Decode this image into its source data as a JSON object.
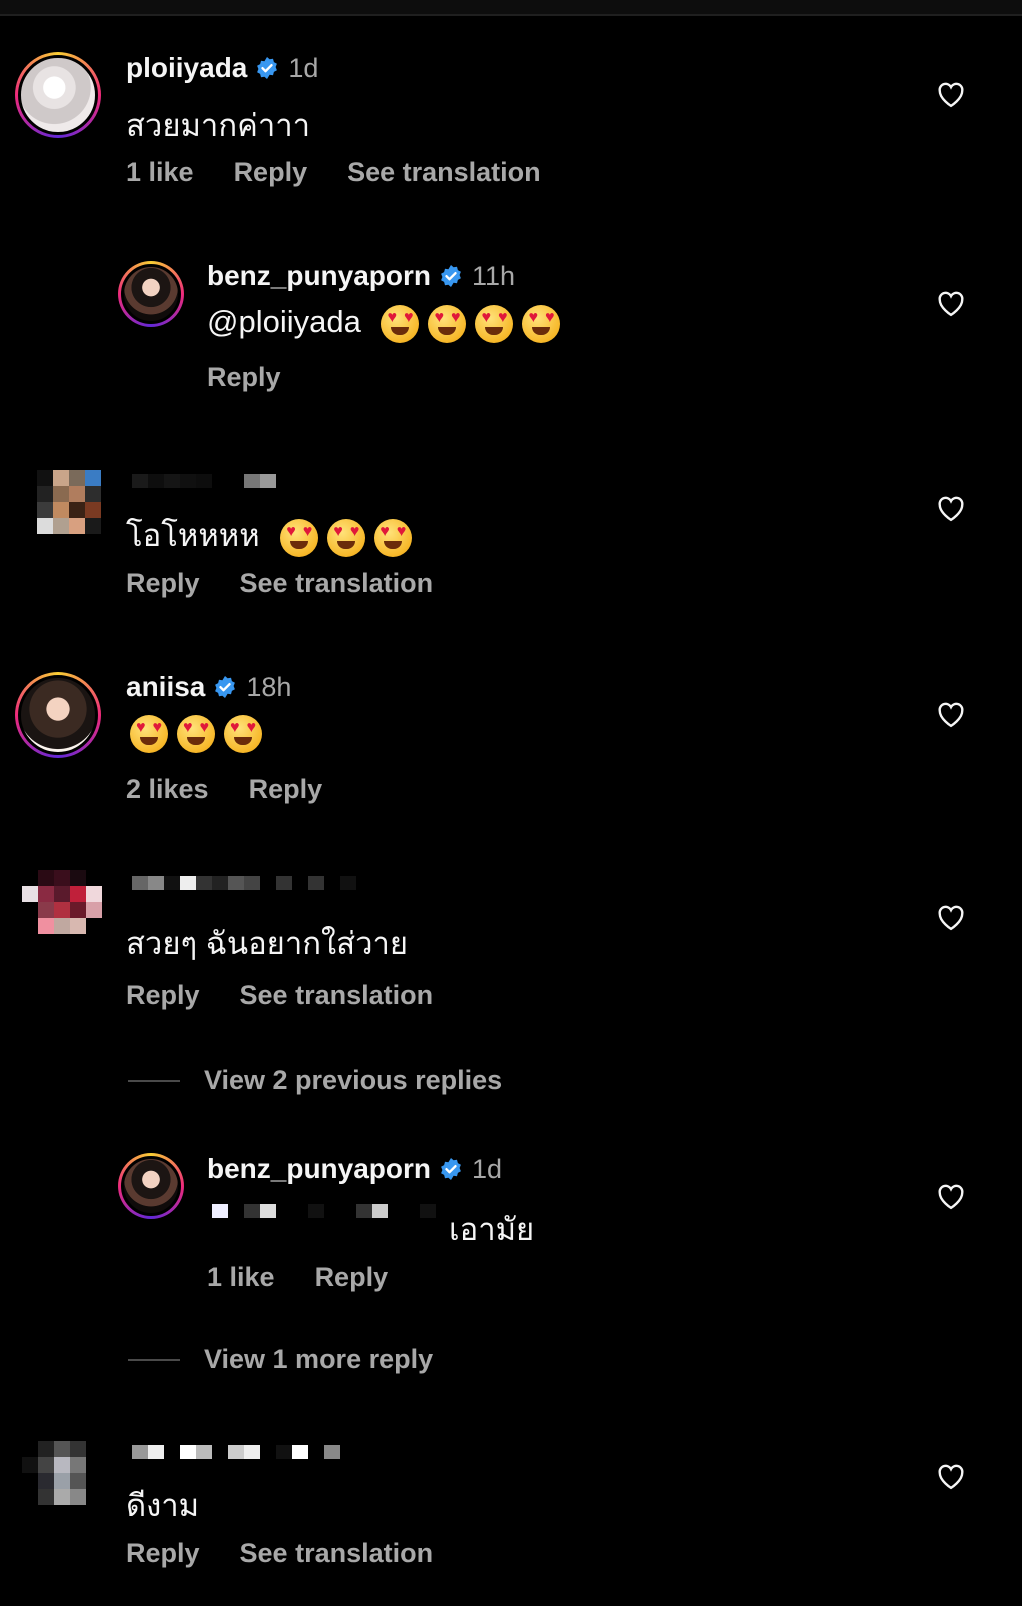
{
  "colors": {
    "background": "#000000",
    "text": "#f5f5f5",
    "secondary": "#a8a8a8",
    "verified": "#3897f0"
  },
  "comments": [
    {
      "username": "ploiiyada",
      "verified": true,
      "time": "1d",
      "text": "สวยมากค่าาา",
      "likes": "1 like",
      "reply": "Reply",
      "translate": "See translation"
    },
    {
      "username": "benz_punyaporn",
      "verified": true,
      "time": "11h",
      "text": "@ploiiyada",
      "emoji_count": 4,
      "reply": "Reply"
    },
    {
      "username": "",
      "text": "โอโหหหห",
      "emoji_count": 3,
      "reply": "Reply",
      "translate": "See translation"
    },
    {
      "username": "aniisa",
      "verified": true,
      "time": "18h",
      "text": "",
      "emoji_count": 3,
      "likes": "2 likes",
      "reply": "Reply"
    },
    {
      "username": "",
      "text": "สวยๆ ฉันอยากใส่วาย",
      "reply": "Reply",
      "translate": "See translation"
    },
    {
      "username": "benz_punyaporn",
      "verified": true,
      "time": "1d",
      "text": "เอามัย",
      "likes": "1 like",
      "reply": "Reply"
    },
    {
      "username": "",
      "text": "ดีงาม",
      "reply": "Reply",
      "translate": "See translation"
    }
  ],
  "view_previous": "View 2 previous replies",
  "view_more": "View 1 more reply",
  "icons": {
    "like": "heart-outline-icon",
    "verified": "verified-badge-icon"
  }
}
